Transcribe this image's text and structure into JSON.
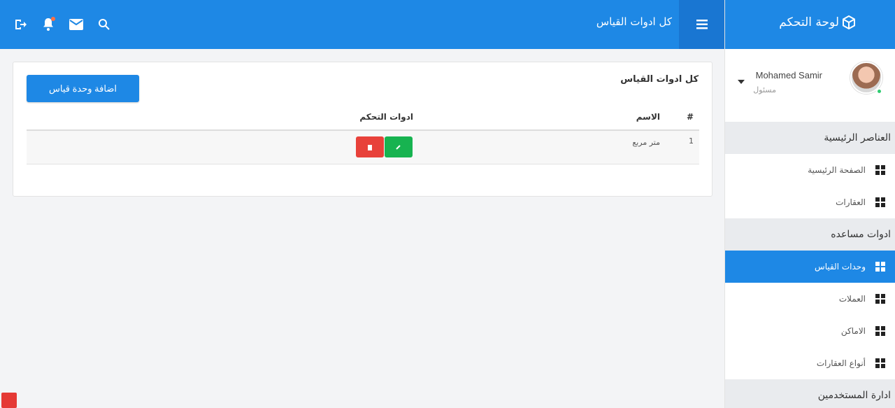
{
  "header": {
    "page_title": "كل ادوات القياس",
    "icons": [
      "logout-icon",
      "bell-icon",
      "mail-icon",
      "search-icon"
    ]
  },
  "sidebar": {
    "brand": "لوحة التحكم",
    "user": {
      "name": "Mohamed Samir",
      "role": "مسئول"
    },
    "sections": [
      {
        "title": "العناصر الرئيسية",
        "items": [
          {
            "label": "الصفحة الرئيسية"
          },
          {
            "label": "العقارات"
          }
        ]
      },
      {
        "title": "ادوات مساعده",
        "items": [
          {
            "label": "وحدات القياس",
            "active": true
          },
          {
            "label": "العملات"
          },
          {
            "label": "الاماكن"
          },
          {
            "label": "أنواع العقارات"
          }
        ]
      },
      {
        "title": "ادارة المستخدمين",
        "items": []
      }
    ]
  },
  "card": {
    "title": "كل ادوات القياس",
    "add_button": "اضافة وحدة قياس",
    "columns": {
      "num": "#",
      "name": "الاسم",
      "tools": "ادوات التحكم"
    },
    "rows": [
      {
        "num": "1",
        "name": "متر مربع"
      }
    ]
  },
  "colors": {
    "primary": "#1e88e5",
    "success": "#17b350",
    "danger": "#e8413a"
  }
}
